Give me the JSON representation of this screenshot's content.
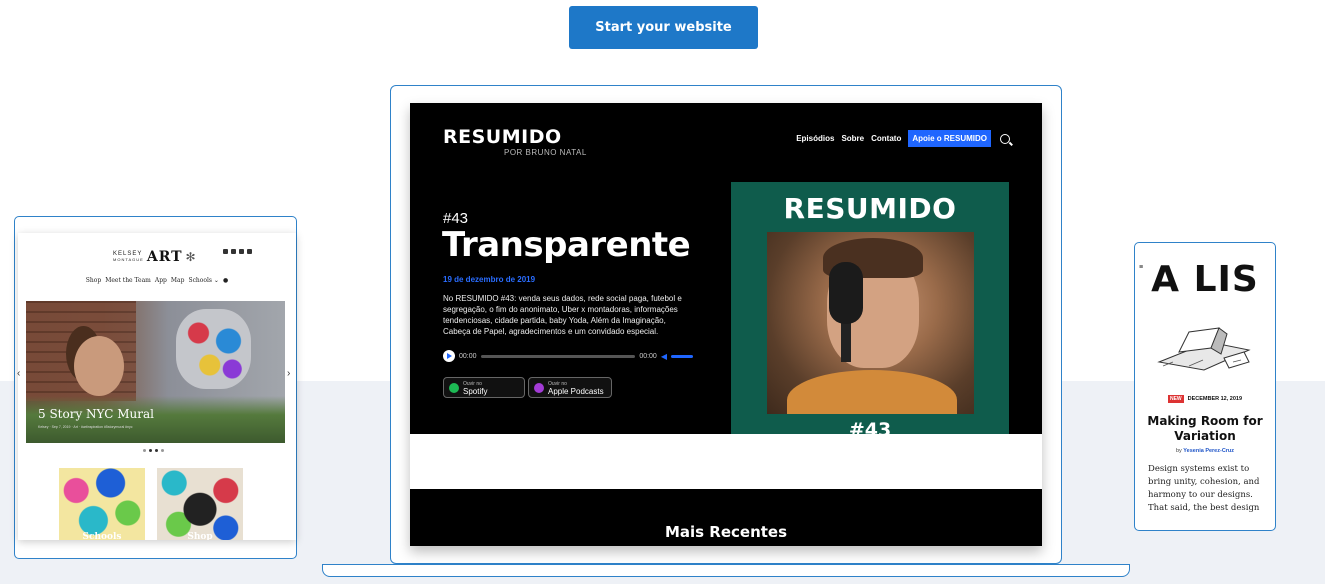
{
  "cta": {
    "label": "Start your website"
  },
  "laptop": {
    "brand": "RESUMIDO",
    "brand_sub": "POR BRUNO NATAL",
    "nav": [
      "Episódios",
      "Sobre",
      "Contato"
    ],
    "nav_cta": "Apoie o RESUMIDO",
    "episode_number": "#43",
    "episode_title": "Transparente",
    "date": "19 de dezembro de 2019",
    "description": "No RESUMIDO #43: venda seus dados, rede social paga, futebol e segregação, o fim do anonimato, Uber x montadoras, informações tendenciosas, cidade partida, baby Yoda, Além da Imaginação, Cabeça de Papel, agradecimentos e um convidado especial.",
    "player": {
      "time_start": "00:00",
      "time_end": "00:00"
    },
    "badges": [
      {
        "small": "Ouvir no",
        "big": "Spotify",
        "color": "#1db954"
      },
      {
        "small": "Ouvir no",
        "big": "Apple Podcasts",
        "color": "#a33bd6"
      }
    ],
    "card": {
      "title": "RESUMIDO",
      "number": "#43"
    },
    "section_title": "Mais Recentes",
    "accent_color": "#1f66ff"
  },
  "tablet": {
    "logo_small_1": "KELSEY",
    "logo_small_2": "MONTAGUE",
    "logo_big": "ART",
    "nav": [
      "Shop",
      "Meet the Team",
      "App",
      "Map",
      "Schools ⌄",
      "●"
    ],
    "hero_title": "5 Story NYC Mural",
    "hero_meta": "Kelsey · Sep 7, 2019 · Art · #artinspiration #5storymural #nyc",
    "tiles": [
      "Schools",
      "Shop"
    ]
  },
  "phone": {
    "menu_icon": "hamburger-icon",
    "big_title": "A LIS",
    "new_badge": "NEW",
    "date": "DECEMBER 12, 2019",
    "title": "Making Room for Variation",
    "by_prefix": "by",
    "author": "Yesenia Perez-Cruz",
    "body": "Design systems exist to bring unity, cohesion, and harmony to our designs. That said, the best design"
  }
}
